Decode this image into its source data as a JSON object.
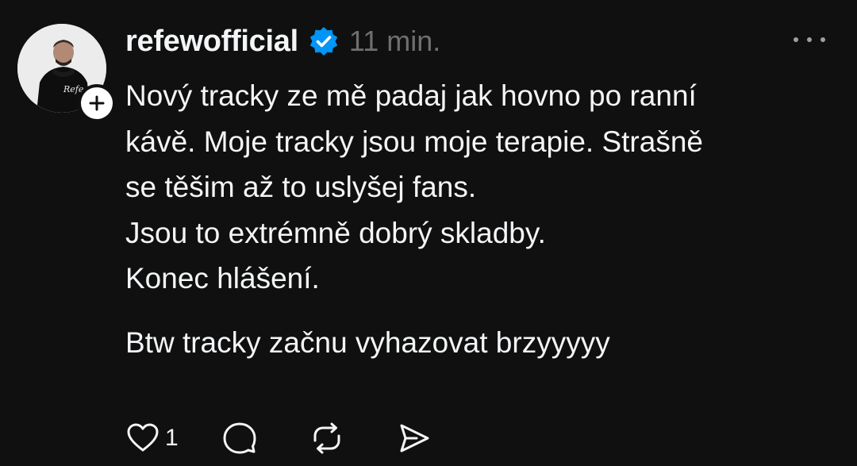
{
  "post": {
    "username": "refewofficial",
    "verified": true,
    "timestamp": "11 min.",
    "body_lines": [
      "Nový tracky ze mě padaj jak hovno po ranní",
      "kávě. Moje tracky jsou moje terapie. Strašně",
      "se těšim až to uslyšej fans.",
      "Jsou to extrémně dobrý skladby.",
      "Konec hlášení."
    ],
    "body_line_2": "Btw tracky začnu vyhazovat brzyyyyy",
    "like_count": "1"
  },
  "colors": {
    "background": "#101010",
    "text": "#f3f5f7",
    "muted": "#6f6f6f",
    "verified_blue": "#0095f6"
  },
  "icons": {
    "avatar": "profile-photo",
    "follow": "plus-icon",
    "verified": "verified-badge-icon",
    "more": "more-horizontal-icon",
    "like": "heart-icon",
    "comment": "comment-icon",
    "repost": "repost-icon",
    "share": "send-icon"
  }
}
